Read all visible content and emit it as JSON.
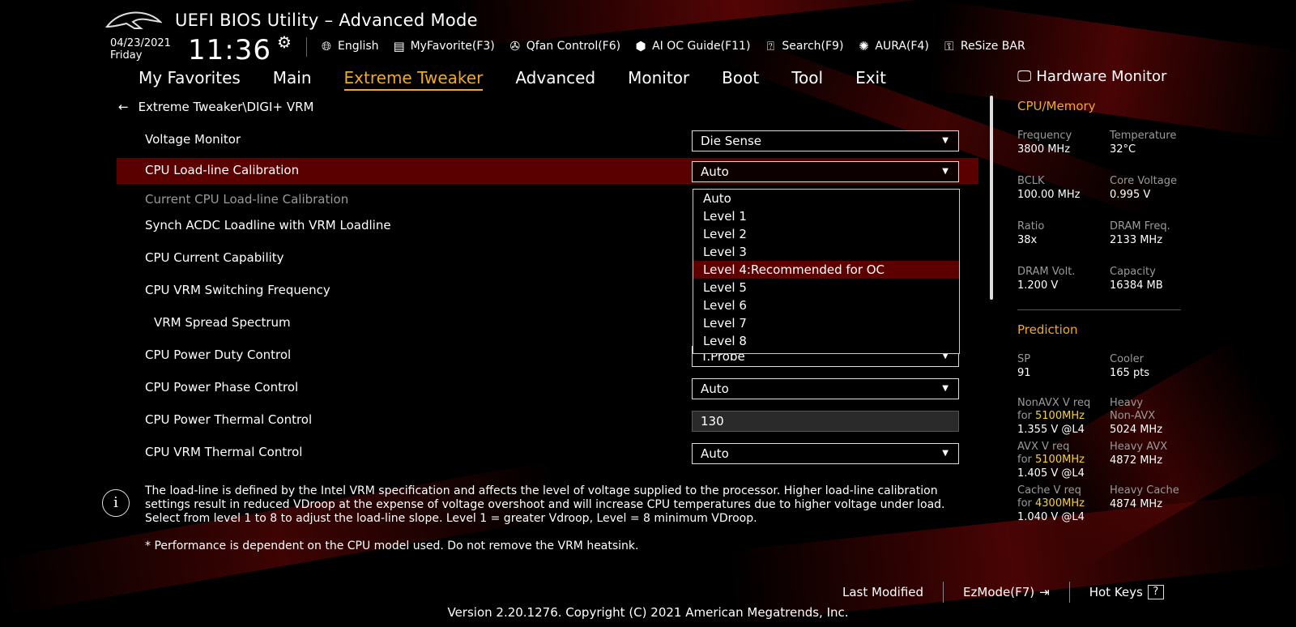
{
  "header": {
    "title": "UEFI BIOS Utility – Advanced Mode",
    "date": "04/23/2021",
    "day": "Friday",
    "time": "11:36"
  },
  "toolbar": {
    "items": [
      {
        "label": "English",
        "icon": "globe-icon"
      },
      {
        "label": "MyFavorite(F3)",
        "icon": "favorite-icon"
      },
      {
        "label": "Qfan Control(F6)",
        "icon": "fan-icon"
      },
      {
        "label": "AI OC Guide(F11)",
        "icon": "ai-oc-icon"
      },
      {
        "label": "Search(F9)",
        "icon": "search-icon"
      },
      {
        "label": "AURA(F4)",
        "icon": "aura-icon"
      },
      {
        "label": "ReSize BAR",
        "icon": "resize-bar-icon"
      }
    ]
  },
  "nav": {
    "items": [
      "My Favorites",
      "Main",
      "Extreme Tweaker",
      "Advanced",
      "Monitor",
      "Boot",
      "Tool",
      "Exit"
    ],
    "active": "Extreme Tweaker"
  },
  "breadcrumb": "Extreme Tweaker\\DIGI+ VRM",
  "settings": [
    {
      "label": "Voltage Monitor",
      "value": "Die Sense"
    },
    {
      "label": "CPU Load-line Calibration",
      "value": "Auto"
    },
    {
      "label": "Current CPU Load-line Calibration",
      "value": ""
    },
    {
      "label": "Synch ACDC Loadline with VRM Loadline",
      "value": ""
    },
    {
      "label": "CPU Current Capability",
      "value": ""
    },
    {
      "label": "CPU VRM Switching Frequency",
      "value": ""
    },
    {
      "label": "VRM Spread Spectrum",
      "value": ""
    },
    {
      "label": "CPU Power Duty Control",
      "value": "T.Probe"
    },
    {
      "label": "CPU Power Phase Control",
      "value": "Auto"
    },
    {
      "label": "CPU Power Thermal Control",
      "value": "130"
    },
    {
      "label": "CPU VRM Thermal Control",
      "value": "Auto"
    }
  ],
  "dropdown": {
    "options": [
      "Auto",
      "Level 1",
      "Level 2",
      "Level 3",
      "Level 4:Recommended for OC",
      "Level 5",
      "Level 6",
      "Level 7",
      "Level 8"
    ],
    "highlighted": "Level 4:Recommended for OC"
  },
  "hardware_monitor": {
    "title": "Hardware Monitor",
    "cpu_memory": {
      "title": "CPU/Memory",
      "frequency_label": "Frequency",
      "frequency": "3800 MHz",
      "temperature_label": "Temperature",
      "temperature": "32°C",
      "bclk_label": "BCLK",
      "bclk": "100.00 MHz",
      "core_voltage_label": "Core Voltage",
      "core_voltage": "0.995 V",
      "ratio_label": "Ratio",
      "ratio": "38x",
      "dram_freq_label": "DRAM Freq.",
      "dram_freq": "2133 MHz",
      "dram_volt_label": "DRAM Volt.",
      "dram_volt": "1.200 V",
      "capacity_label": "Capacity",
      "capacity": "16384 MB"
    },
    "prediction": {
      "title": "Prediction",
      "sp_label": "SP",
      "sp": "91",
      "cooler_label": "Cooler",
      "cooler": "165 pts",
      "nonavx_label": "NonAVX V req",
      "nonavx_for": "for",
      "nonavx_freq": "5100MHz",
      "nonavx_value": "1.355 V @L4",
      "heavy_nonavx_label1": "Heavy",
      "heavy_nonavx_label2": "Non-AVX",
      "heavy_nonavx_value": "5024 MHz",
      "avx_label": "AVX V req",
      "avx_for": "for",
      "avx_freq": "5100MHz",
      "avx_value": "1.405 V @L4",
      "heavy_avx_label": "Heavy AVX",
      "heavy_avx_value": "4872 MHz",
      "cache_label": "Cache V req",
      "cache_for": "for",
      "cache_freq": "4300MHz",
      "cache_value": "1.040 V @L4",
      "heavy_cache_label": "Heavy Cache",
      "heavy_cache_value": "4874 MHz"
    }
  },
  "help": {
    "text": "The load-line is defined by the Intel VRM specification and affects the level of voltage supplied to the processor. Higher load-line calibration settings result in reduced VDroop at the expense of voltage overshoot and will increase CPU temperatures due to higher voltage under load. Select from level 1 to 8 to adjust the load-line slope. Level 1 = greater Vdroop, Level = 8 minimum VDroop.",
    "note": "* Performance is dependent on the CPU model used. Do not remove the VRM heatsink."
  },
  "footer": {
    "last_modified": "Last Modified",
    "ezmode": "EzMode(F7)",
    "hot_keys": "Hot Keys",
    "hot_keys_glyph": "?",
    "version": "Version 2.20.1276. Copyright (C) 2021 American Megatrends, Inc."
  },
  "colors": {
    "accent": "#f0a92b",
    "highlight_yellow": "#f2d33a",
    "selection_red": "#780000"
  }
}
